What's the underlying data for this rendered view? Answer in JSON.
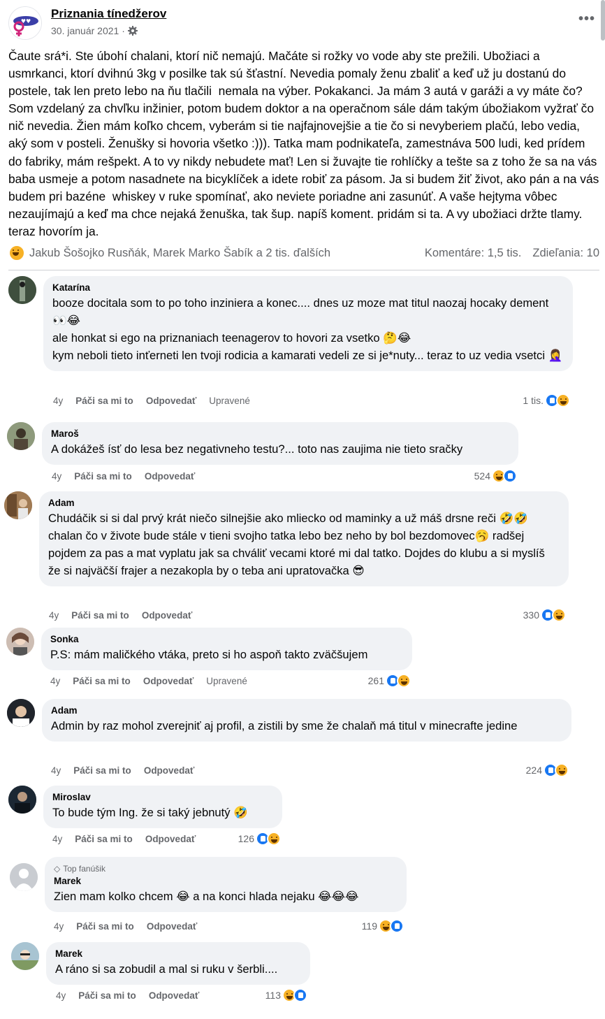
{
  "post": {
    "page_name": "Priznania tínedžerov",
    "date": "30. január 2021 ·",
    "more_label": "•••",
    "text": "Čaute srá*i. Ste úbohí chalani, ktorí nič nemajú. Mačáte si rožky vo vode aby ste prežili. Ubožiaci a usmrkanci, ktorí dvihnú 3kg v posilke tak sú šťastní. Nevedia pomaly ženu zbaliť a keď už ju dostanú do postele, tak len preto lebo na ňu tlačili  nemala na výber. Pokakanci. Ja mám 3 autá v garáži a vy máte čo? Som vzdelaný za chvľku inžinier, potom budem doktor a na operačnom sále dám takým úbožiakom vyžrať čo nič nevedia. Žien mám koľko chcem, vyberám si tie najfajnovejšie a tie čo si nevyberiem plačú, lebo vedia, aký som v posteli. Ženušky si hovoria všetko :))). Tatka mam podnikateľa, zamestnáva 500 ludi, ked prídem do fabriky, mám rešpekt. A to vy nikdy nebudete mať! Len si žuvajte tie rohlíčky a tešte sa z toho že sa na vás baba usmeje a potom nasadnete na bicyklíček a idete robiť za pásom. Ja si budem žiť život, ako pán a na vás budem pri bazéne  whiskey v ruke spomínať, ako neviete poriadne ani zasunúť. A vaše hejtyma vôbec nezaujímajú a keď ma chce nejaká ženuška, tak šup. napíš koment. pridám si ta. A vy ubožiaci držte tlamy. teraz hovorím ja.",
    "reactors": "Jakub Šošojko Rusňák, Marek Marko Šabík a 2 tis. ďalších",
    "comments_count": "Komentáre: 1,5 tis.",
    "shares_count": "Zdieľania: 10"
  },
  "actions": {
    "age": "4y",
    "like": "Páči sa mi to",
    "reply": "Odpovedať",
    "edited": "Upravené"
  },
  "comments": [
    {
      "name": "Katarína",
      "text": "booze docitala som to po toho inziniera a konec.... dnes uz moze mat titul naozaj hocaky dement 👀😂\nale honkat si ego na priznaniach teenagerov to hovori za vsetko 🤔😂\nkym neboli tieto inťerneti len tvoji rodicia a kamarati vedeli ze si je*nuty... teraz to uz vedia vsetci 🤦‍♀️",
      "reactions": "1 tis.",
      "edited": true
    },
    {
      "name": "Maroš",
      "text": "A dokážeš ísť do lesa bez negativneho testu?... toto nas zaujima nie tieto sračky",
      "reactions": "524",
      "edited": false
    },
    {
      "name": "Adam",
      "text": "Chudáčik si si dal prvý krát niečo silnejšie ako mliecko od maminky a už máš drsne reči 🤣🤣 chalan čo v živote bude stále v tieni svojho tatka lebo bez neho by bol bezdomovec🥱 radšej pojdem za pas a mat vyplatu jak sa chváliť vecami ktoré mi dal tatko. Dojdes do klubu a si myslíš že si najväčší frajer a nezakopla by o teba ani upratovačka 😎",
      "reactions": "330",
      "edited": false
    },
    {
      "name": "Sonka",
      "text": "P.S: mám maličkého vtáka, preto si ho aspoň takto zväčšujem",
      "reactions": "261",
      "edited": true
    },
    {
      "name": "Adam",
      "text": "Admin by raz mohol zverejniť aj profil, a zistili by sme že chalaň má titul v minecrafte jedine",
      "reactions": "224",
      "edited": false
    },
    {
      "name": "Miroslav",
      "text": "To bude tým Ing. že si taký jebnutý 🤣",
      "reactions": "126",
      "edited": false
    },
    {
      "name": "Marek",
      "badge": "Top fanúšik",
      "text": "Zien mam kolko chcem 😂 a na konci hlada nejaku 😂😂😂",
      "reactions": "119",
      "edited": false
    },
    {
      "name": "Marek",
      "text": "A ráno si sa zobudil a mal si ruku v šerbli....",
      "reactions": "113",
      "edited": false
    }
  ],
  "colors": {
    "like": "#1877f2",
    "haha": "#f7b125",
    "bubble": "#f0f2f5",
    "meta": "#65676b"
  }
}
